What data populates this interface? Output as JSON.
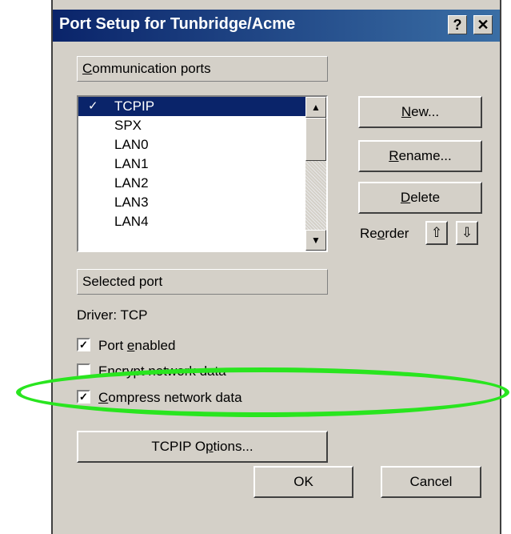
{
  "dialog": {
    "title": "Port Setup for Tunbridge/Acme",
    "help_glyph": "?",
    "close_glyph": "✕"
  },
  "communication_ports": {
    "header": "Communication ports",
    "items": [
      {
        "label": "TCPIP",
        "selected": true,
        "checked": true
      },
      {
        "label": "SPX"
      },
      {
        "label": "LAN0"
      },
      {
        "label": "LAN1"
      },
      {
        "label": "LAN2"
      },
      {
        "label": "LAN3"
      },
      {
        "label": "LAN4"
      }
    ],
    "check_mark": "✓"
  },
  "buttons": {
    "new": {
      "label": "New...",
      "mnemonic": "N",
      "rest": "ew..."
    },
    "rename": {
      "label": "Rename...",
      "mnemonic": "R",
      "rest": "ename..."
    },
    "delete": {
      "label": "Delete",
      "mnemonic": "D",
      "rest": "elete"
    },
    "tcpip_options": {
      "label": "TCPIP Options...",
      "before": "TCPIP O",
      "mnemonic": "p",
      "rest": "tions..."
    },
    "ok": "OK",
    "cancel": "Cancel"
  },
  "reorder": {
    "label_before": "Re",
    "mnemonic": "o",
    "label_after": "rder",
    "up_icon": "⇧",
    "down_icon": "⇩"
  },
  "selected_port": {
    "header": "Selected port",
    "driver": "Driver: TCP"
  },
  "options": [
    {
      "before": "Port ",
      "mnemonic": "e",
      "after": "nabled",
      "checked": true
    },
    {
      "before": "Encrypt network data",
      "mnemonic": "",
      "after": "",
      "checked": false
    },
    {
      "before": "",
      "mnemonic": "C",
      "after": "ompress network data",
      "checked": true
    }
  ],
  "highlight_color": "#29e51f"
}
